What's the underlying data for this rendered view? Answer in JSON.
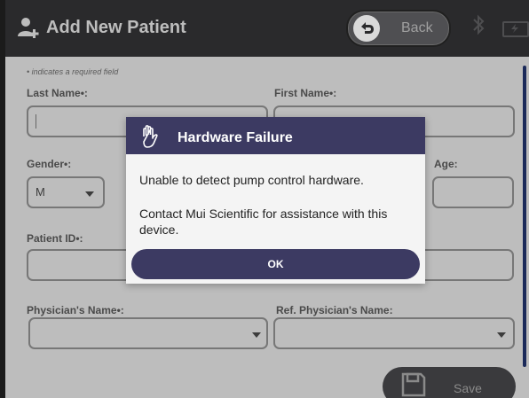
{
  "header": {
    "title": "Add New Patient",
    "back_label": "Back",
    "icons": [
      "add-user-icon",
      "bluetooth-icon",
      "battery-charging-icon"
    ]
  },
  "form": {
    "required_note": "• indicates a required field",
    "last_name_label": "Last Name•:",
    "last_name_value": "",
    "first_name_label": "First Name•:",
    "first_name_value": "",
    "gender_label": "Gender•:",
    "gender_value": "M",
    "age_label": "Age:",
    "age_value": "",
    "patient_id_label": "Patient ID•:",
    "patient_id_value": "",
    "physician_label": "Physician's Name•:",
    "physician_value": "",
    "ref_physician_label": "Ref. Physician's Name:",
    "ref_physician_value": "",
    "save_label": "Save"
  },
  "dialog": {
    "title": "Hardware Failure",
    "message1": "Unable to detect pump control hardware.",
    "message2": "Contact Mui Scientific for assistance with this device.",
    "ok_label": "OK"
  },
  "colors": {
    "dialog_header": "#3c3a62",
    "header_bg": "#2a2a2c",
    "body_bg": "#bdbdbd"
  }
}
